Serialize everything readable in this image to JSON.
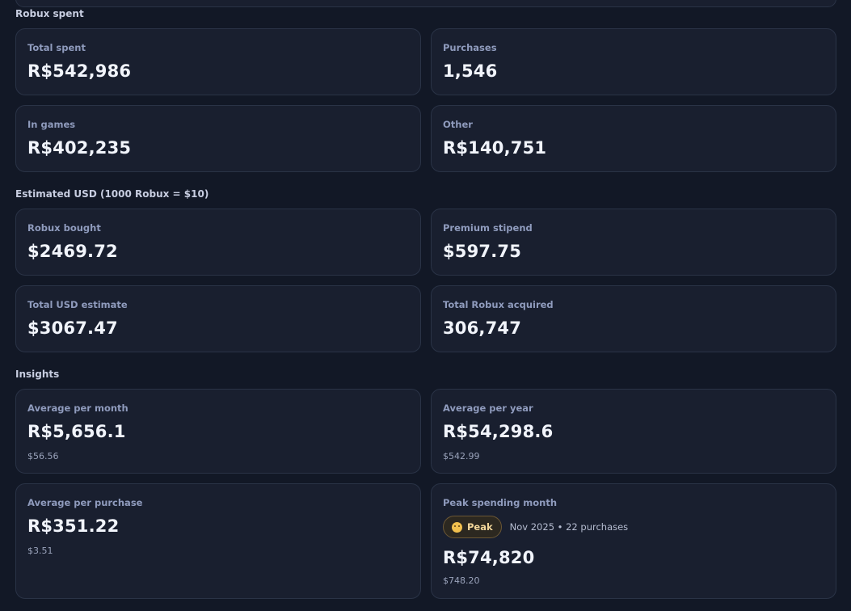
{
  "sections": {
    "robux_spent": "Robux spent",
    "estimated_usd": "Estimated USD (1000 Robux = $10)",
    "insights": "Insights"
  },
  "robux_spent": {
    "total_spent": {
      "label": "Total spent",
      "value": "R$542,986"
    },
    "purchases": {
      "label": "Purchases",
      "value": "1,546"
    },
    "in_games": {
      "label": "In games",
      "value": "R$402,235"
    },
    "other": {
      "label": "Other",
      "value": "R$140,751"
    }
  },
  "estimated_usd": {
    "robux_bought": {
      "label": "Robux bought",
      "value": "$2469.72"
    },
    "premium_stipend": {
      "label": "Premium stipend",
      "value": "$597.75"
    },
    "total_usd_estimate": {
      "label": "Total USD estimate",
      "value": "$3067.47"
    },
    "total_robux_acquired": {
      "label": "Total Robux acquired",
      "value": "306,747"
    }
  },
  "insights": {
    "avg_month": {
      "label": "Average per month",
      "value": "R$5,656.1",
      "sub": "$56.56"
    },
    "avg_year": {
      "label": "Average per year",
      "value": "R$54,298.6",
      "sub": "$542.99"
    },
    "avg_purchase": {
      "label": "Average per purchase",
      "value": "R$351.22",
      "sub": "$3.51"
    },
    "peak_month": {
      "label": "Peak spending month",
      "badge": "Peak",
      "badge_icon": "smiley-face-icon",
      "meta": "Nov 2025 • 22 purchases",
      "value": "R$74,820",
      "sub": "$748.20"
    }
  },
  "colors": {
    "background": "#121826",
    "card": "#191f2f",
    "border": "#2a3346",
    "label": "#8f9bbd",
    "peak_badge_text": "#f3d79a"
  }
}
